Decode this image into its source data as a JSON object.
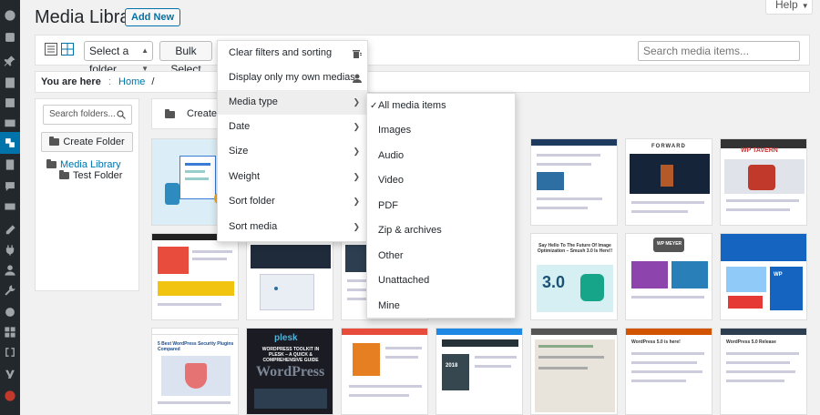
{
  "header": {
    "title": "Media Library",
    "add_new": "Add New",
    "help": "Help"
  },
  "toolbar": {
    "folder_select": "Select a folder",
    "bulk_select": "Bulk Select",
    "search_placeholder": "Search media items..."
  },
  "breadcrumb": {
    "prefix": "You are here",
    "home": "Home",
    "separator": "/"
  },
  "folders": {
    "search_placeholder": "Search folders...",
    "create_button": "Create Folder",
    "root": "Media Library",
    "child": "Test Folder",
    "strip_label": "Create Fo"
  },
  "filter_menu": {
    "items": [
      {
        "label": "Clear filters and sorting",
        "icon": "trash-filter-icon"
      },
      {
        "label": "Display only my own medias",
        "icon": "user-icon"
      },
      {
        "label": "Media type",
        "icon": "chevron-right-icon"
      },
      {
        "label": "Date",
        "icon": "chevron-right-icon"
      },
      {
        "label": "Size",
        "icon": "chevron-right-icon"
      },
      {
        "label": "Weight",
        "icon": "chevron-right-icon"
      },
      {
        "label": "Sort folder",
        "icon": "chevron-right-icon"
      },
      {
        "label": "Sort media",
        "icon": "chevron-right-icon"
      }
    ]
  },
  "media_type_submenu": {
    "items": [
      "All media items",
      "Images",
      "Audio",
      "Video",
      "PDF",
      "Zip & archives",
      "Other",
      "Unattached",
      "Mine"
    ],
    "selected": "All media items"
  },
  "thumbnails": {
    "tavern": "WP TAVERN",
    "forward": "FORWARD",
    "smush_lead": "Say Hello To The Future Of Image Optimization – Smush 3.0 Is Here!!",
    "smush_version": "3.0",
    "meyer": "WP MEYER",
    "wp_logo": "WP",
    "plesk_top": "plesk",
    "plesk_title": "WORDPRESS TOOLKIT IN PLESK – A QUICK & COMPREHENSIVE GUIDE",
    "plesk_bottom": "WordPress",
    "security": "5 Best WordPress Security Plugins Compared",
    "year": "2018",
    "wordpress5": "WordPress 5.0 is here!",
    "wpengine": "WordPress 5.0 Release"
  },
  "colors": {
    "admin_dark": "#23282d",
    "accent": "#0073aa"
  }
}
